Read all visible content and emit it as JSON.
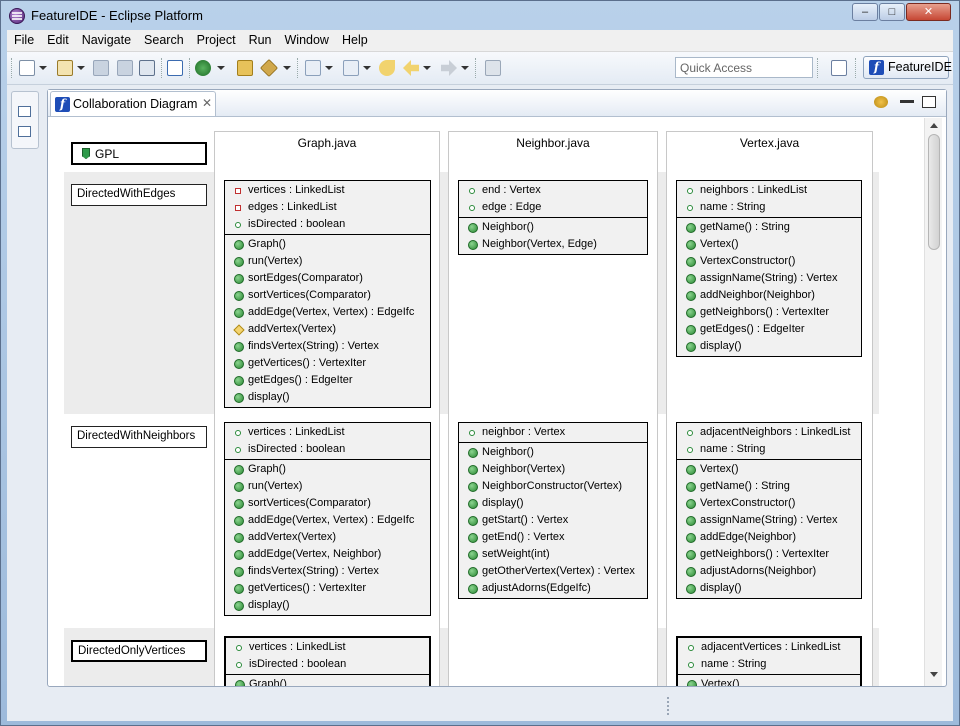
{
  "window": {
    "title": "FeatureIDE - Eclipse Platform",
    "controls": {
      "minimize": "–",
      "maximize": "□",
      "close": "✕"
    }
  },
  "menu": [
    "File",
    "Edit",
    "Navigate",
    "Search",
    "Project",
    "Run",
    "Window",
    "Help"
  ],
  "toolbar": {
    "quick_access_placeholder": "Quick Access",
    "perspective_label": "FeatureIDE",
    "icons": [
      "new-icon",
      "new-project-icon",
      "save-icon",
      "save-all-icon",
      "print-icon",
      "open-file-icon",
      "run-icon",
      "open-folder-icon",
      "wand-icon",
      "next-annotation-icon",
      "prev-annotation-icon",
      "last-edit-icon",
      "back-icon",
      "forward-icon",
      "pin-icon"
    ]
  },
  "editor": {
    "tab_label": "Collaboration Diagram",
    "tab_close": "✕"
  },
  "diagram": {
    "root_feature": "GPL",
    "columns": [
      "Graph.java",
      "Neighbor.java",
      "Vertex.java"
    ],
    "roles": [
      {
        "feature": "DirectedWithEdges",
        "graph": {
          "fields": [
            {
              "text": "vertices : LinkedList",
              "kind": "field-priv"
            },
            {
              "text": "edges : LinkedList",
              "kind": "field-priv"
            },
            {
              "text": "isDirected : boolean",
              "kind": "field"
            }
          ],
          "methods": [
            {
              "text": "Graph()",
              "kind": "method"
            },
            {
              "text": "run(Vertex)",
              "kind": "method"
            },
            {
              "text": "sortEdges(Comparator)",
              "kind": "method"
            },
            {
              "text": "sortVertices(Comparator)",
              "kind": "method"
            },
            {
              "text": "addEdge(Vertex, Vertex) : EdgeIfc",
              "kind": "method"
            },
            {
              "text": "addVertex(Vertex)",
              "kind": "method-prot"
            },
            {
              "text": "findsVertex(String) : Vertex",
              "kind": "method"
            },
            {
              "text": "getVertices() : VertexIter",
              "kind": "method"
            },
            {
              "text": "getEdges() : EdgeIter",
              "kind": "method"
            },
            {
              "text": "display()",
              "kind": "method"
            }
          ]
        },
        "neighbor": {
          "fields": [
            {
              "text": "end : Vertex",
              "kind": "field"
            },
            {
              "text": "edge : Edge",
              "kind": "field"
            }
          ],
          "methods": [
            {
              "text": "Neighbor()",
              "kind": "method"
            },
            {
              "text": "Neighbor(Vertex, Edge)",
              "kind": "method"
            }
          ]
        },
        "vertex": {
          "fields": [
            {
              "text": "neighbors : LinkedList",
              "kind": "field"
            },
            {
              "text": "name : String",
              "kind": "field"
            }
          ],
          "methods": [
            {
              "text": "getName() : String",
              "kind": "method"
            },
            {
              "text": "Vertex()",
              "kind": "method"
            },
            {
              "text": "VertexConstructor()",
              "kind": "method"
            },
            {
              "text": "assignName(String) : Vertex",
              "kind": "method"
            },
            {
              "text": "addNeighbor(Neighbor)",
              "kind": "method"
            },
            {
              "text": "getNeighbors() : VertexIter",
              "kind": "method"
            },
            {
              "text": "getEdges() : EdgeIter",
              "kind": "method"
            },
            {
              "text": "display()",
              "kind": "method"
            }
          ]
        }
      },
      {
        "feature": "DirectedWithNeighbors",
        "graph": {
          "fields": [
            {
              "text": "vertices : LinkedList",
              "kind": "field"
            },
            {
              "text": "isDirected : boolean",
              "kind": "field"
            }
          ],
          "methods": [
            {
              "text": "Graph()",
              "kind": "method"
            },
            {
              "text": "run(Vertex)",
              "kind": "method"
            },
            {
              "text": "sortVertices(Comparator)",
              "kind": "method"
            },
            {
              "text": "addEdge(Vertex, Vertex) : EdgeIfc",
              "kind": "method"
            },
            {
              "text": "addVertex(Vertex)",
              "kind": "method"
            },
            {
              "text": "addEdge(Vertex, Neighbor)",
              "kind": "method"
            },
            {
              "text": "findsVertex(String) : Vertex",
              "kind": "method"
            },
            {
              "text": "getVertices() : VertexIter",
              "kind": "method"
            },
            {
              "text": "display()",
              "kind": "method"
            }
          ]
        },
        "neighbor": {
          "fields": [
            {
              "text": "neighbor : Vertex",
              "kind": "field"
            }
          ],
          "methods": [
            {
              "text": "Neighbor()",
              "kind": "method"
            },
            {
              "text": "Neighbor(Vertex)",
              "kind": "method"
            },
            {
              "text": "NeighborConstructor(Vertex)",
              "kind": "method"
            },
            {
              "text": "display()",
              "kind": "method"
            },
            {
              "text": "getStart() : Vertex",
              "kind": "method"
            },
            {
              "text": "getEnd() : Vertex",
              "kind": "method"
            },
            {
              "text": "setWeight(int)",
              "kind": "method"
            },
            {
              "text": "getOtherVertex(Vertex) : Vertex",
              "kind": "method"
            },
            {
              "text": "adjustAdorns(EdgeIfc)",
              "kind": "method"
            }
          ]
        },
        "vertex": {
          "fields": [
            {
              "text": "adjacentNeighbors : LinkedList",
              "kind": "field"
            },
            {
              "text": "name : String",
              "kind": "field"
            }
          ],
          "methods": [
            {
              "text": "Vertex()",
              "kind": "method"
            },
            {
              "text": "getName() : String",
              "kind": "method"
            },
            {
              "text": "VertexConstructor()",
              "kind": "method"
            },
            {
              "text": "assignName(String) : Vertex",
              "kind": "method"
            },
            {
              "text": "addEdge(Neighbor)",
              "kind": "method"
            },
            {
              "text": "getNeighbors() : VertexIter",
              "kind": "method"
            },
            {
              "text": "adjustAdorns(Neighbor)",
              "kind": "method"
            },
            {
              "text": "display()",
              "kind": "method"
            }
          ]
        }
      },
      {
        "feature": "DirectedOnlyVertices",
        "graph": {
          "fields": [
            {
              "text": "vertices : LinkedList",
              "kind": "field"
            },
            {
              "text": "isDirected : boolean",
              "kind": "field"
            }
          ],
          "methods": [
            {
              "text": "Graph()",
              "kind": "method"
            }
          ]
        },
        "neighbor": null,
        "vertex": {
          "fields": [
            {
              "text": "adjacentVertices : LinkedList",
              "kind": "field"
            },
            {
              "text": "name : String",
              "kind": "field"
            }
          ],
          "methods": [
            {
              "text": "Vertex()",
              "kind": "method"
            }
          ]
        }
      }
    ]
  }
}
